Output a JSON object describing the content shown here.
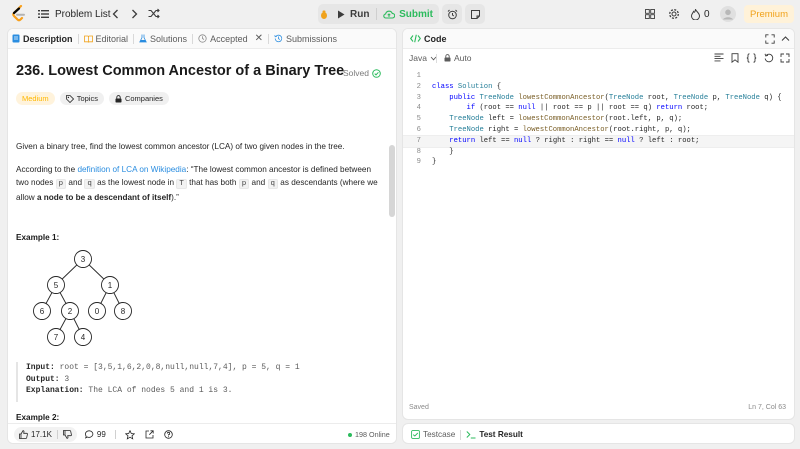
{
  "topbar": {
    "problem_list": "Problem List",
    "run": "Run",
    "submit": "Submit",
    "streak": "0",
    "premium": "Premium"
  },
  "left_tabs": [
    {
      "label": "Description",
      "icon": "document-icon"
    },
    {
      "label": "Editorial",
      "icon": "book-icon"
    },
    {
      "label": "Solutions",
      "icon": "flask-icon"
    },
    {
      "label": "Accepted",
      "icon": "clock-icon"
    },
    {
      "label": "Submissions",
      "icon": "history-icon"
    }
  ],
  "problem": {
    "title": "236. Lowest Common Ancestor of a Binary Tree",
    "status": "Solved",
    "difficulty": "Medium",
    "topics": "Topics",
    "companies": "Companies",
    "intro": "Given a binary tree, find the lowest common ancestor (LCA) of two given nodes in the tree.",
    "def_prefix": "According to the ",
    "def_link": "definition of LCA on Wikipedia",
    "def_text1": ": “The lowest common ancestor is defined between two nodes ",
    "p": "p",
    "and": " and ",
    "q": "q",
    "def_text2": " as the lowest node in ",
    "T": "T",
    "def_text3": " that has both ",
    "def_text4": " as descendants (where we allow ",
    "def_bold": "a node to be a descendant of itself",
    "def_end": ").”",
    "example1_title": "Example 1:",
    "example2_title": "Example 2:",
    "input_label": "Input:",
    "input_value": " root = [3,5,1,6,2,0,8,null,null,7,4], p = 5, q = 1",
    "output_label": "Output:",
    "output_value": " 3",
    "explanation_label": "Explanation:",
    "explanation_value": " The LCA of nodes 5 and 1 is 3.",
    "tree_nodes": [
      "3",
      "5",
      "1",
      "6",
      "2",
      "0",
      "8",
      "7",
      "4"
    ],
    "example2_node": "3"
  },
  "footer": {
    "likes": "17.1K",
    "comments": "99",
    "online": "198 Online"
  },
  "code_panel": {
    "title": "Code",
    "language": "Java",
    "mode": "Auto",
    "saved": "Saved",
    "cursor": "Ln 7, Col 63"
  },
  "code_lines": [
    {
      "n": "1",
      "text": ""
    },
    {
      "n": "2",
      "text": "class Solution {"
    },
    {
      "n": "3",
      "text": "    public TreeNode lowestCommonAncestor(TreeNode root, TreeNode p, TreeNode q) {"
    },
    {
      "n": "4",
      "text": "        if (root == null || root == p || root == q) return root;"
    },
    {
      "n": "5",
      "text": "    TreeNode left = lowestCommonAncestor(root.left, p, q);"
    },
    {
      "n": "6",
      "text": "    TreeNode right = lowestCommonAncestor(root.right, p, q);"
    },
    {
      "n": "7",
      "text": "    return left == null ? right : right == null ? left : root;"
    },
    {
      "n": "8",
      "text": "    }"
    },
    {
      "n": "9",
      "text": "}"
    }
  ],
  "bottom_tabs": {
    "testcase": "Testcase",
    "result": "Test Result"
  }
}
